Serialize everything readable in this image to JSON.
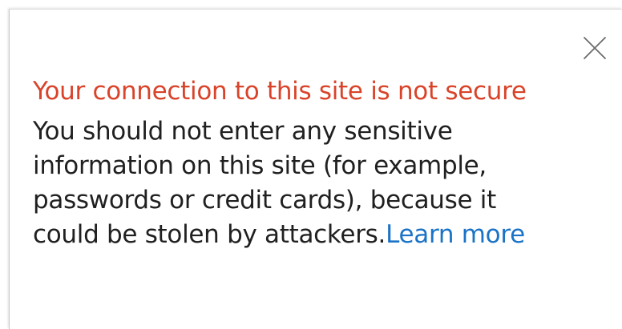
{
  "popup": {
    "title": "Your connection to this site is not secure",
    "message": "You should not enter any sensitive information on this site (for example, passwords or credit cards), because it could be stolen by attackers.",
    "learn_more_label": "Learn more",
    "close_icon": "close-icon"
  },
  "colors": {
    "title": "#d9432a",
    "text": "#202020",
    "link": "#1a73c6"
  }
}
